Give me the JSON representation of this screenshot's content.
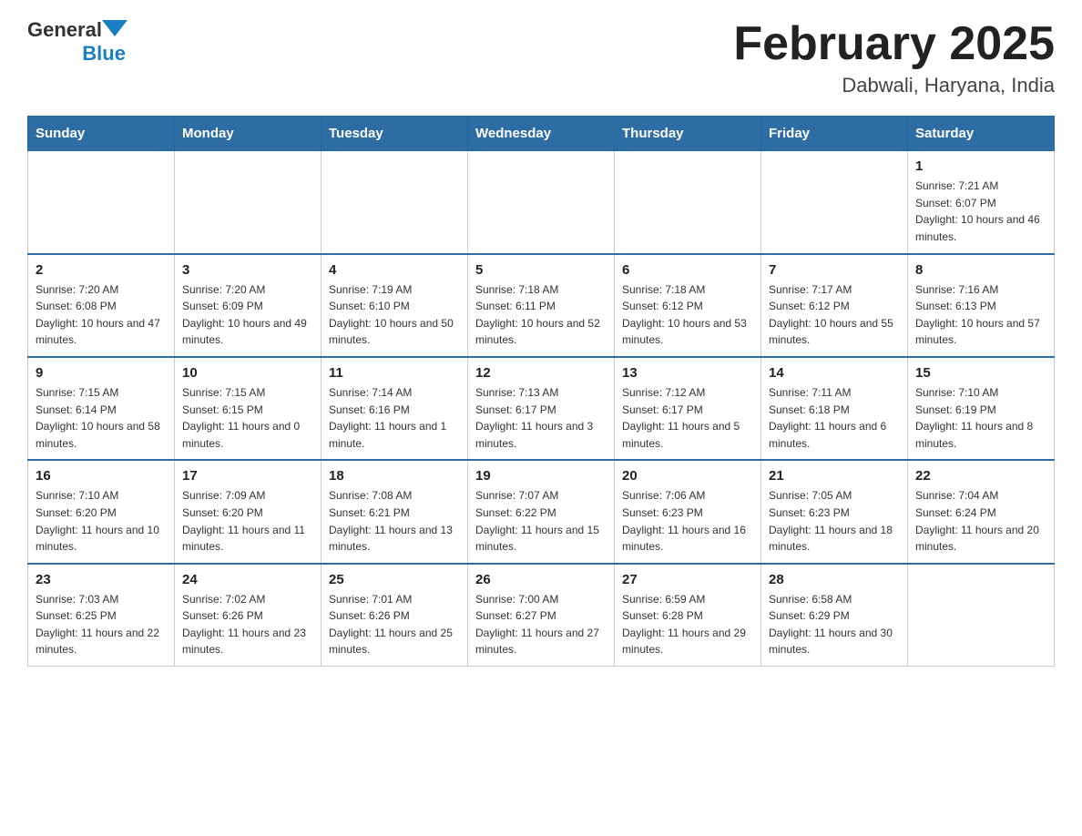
{
  "header": {
    "logo": {
      "general": "General",
      "blue": "Blue"
    },
    "title": "February 2025",
    "subtitle": "Dabwali, Haryana, India"
  },
  "weekdays": [
    "Sunday",
    "Monday",
    "Tuesday",
    "Wednesday",
    "Thursday",
    "Friday",
    "Saturday"
  ],
  "weeks": [
    [
      {
        "day": "",
        "info": ""
      },
      {
        "day": "",
        "info": ""
      },
      {
        "day": "",
        "info": ""
      },
      {
        "day": "",
        "info": ""
      },
      {
        "day": "",
        "info": ""
      },
      {
        "day": "",
        "info": ""
      },
      {
        "day": "1",
        "info": "Sunrise: 7:21 AM\nSunset: 6:07 PM\nDaylight: 10 hours and 46 minutes."
      }
    ],
    [
      {
        "day": "2",
        "info": "Sunrise: 7:20 AM\nSunset: 6:08 PM\nDaylight: 10 hours and 47 minutes."
      },
      {
        "day": "3",
        "info": "Sunrise: 7:20 AM\nSunset: 6:09 PM\nDaylight: 10 hours and 49 minutes."
      },
      {
        "day": "4",
        "info": "Sunrise: 7:19 AM\nSunset: 6:10 PM\nDaylight: 10 hours and 50 minutes."
      },
      {
        "day": "5",
        "info": "Sunrise: 7:18 AM\nSunset: 6:11 PM\nDaylight: 10 hours and 52 minutes."
      },
      {
        "day": "6",
        "info": "Sunrise: 7:18 AM\nSunset: 6:12 PM\nDaylight: 10 hours and 53 minutes."
      },
      {
        "day": "7",
        "info": "Sunrise: 7:17 AM\nSunset: 6:12 PM\nDaylight: 10 hours and 55 minutes."
      },
      {
        "day": "8",
        "info": "Sunrise: 7:16 AM\nSunset: 6:13 PM\nDaylight: 10 hours and 57 minutes."
      }
    ],
    [
      {
        "day": "9",
        "info": "Sunrise: 7:15 AM\nSunset: 6:14 PM\nDaylight: 10 hours and 58 minutes."
      },
      {
        "day": "10",
        "info": "Sunrise: 7:15 AM\nSunset: 6:15 PM\nDaylight: 11 hours and 0 minutes."
      },
      {
        "day": "11",
        "info": "Sunrise: 7:14 AM\nSunset: 6:16 PM\nDaylight: 11 hours and 1 minute."
      },
      {
        "day": "12",
        "info": "Sunrise: 7:13 AM\nSunset: 6:17 PM\nDaylight: 11 hours and 3 minutes."
      },
      {
        "day": "13",
        "info": "Sunrise: 7:12 AM\nSunset: 6:17 PM\nDaylight: 11 hours and 5 minutes."
      },
      {
        "day": "14",
        "info": "Sunrise: 7:11 AM\nSunset: 6:18 PM\nDaylight: 11 hours and 6 minutes."
      },
      {
        "day": "15",
        "info": "Sunrise: 7:10 AM\nSunset: 6:19 PM\nDaylight: 11 hours and 8 minutes."
      }
    ],
    [
      {
        "day": "16",
        "info": "Sunrise: 7:10 AM\nSunset: 6:20 PM\nDaylight: 11 hours and 10 minutes."
      },
      {
        "day": "17",
        "info": "Sunrise: 7:09 AM\nSunset: 6:20 PM\nDaylight: 11 hours and 11 minutes."
      },
      {
        "day": "18",
        "info": "Sunrise: 7:08 AM\nSunset: 6:21 PM\nDaylight: 11 hours and 13 minutes."
      },
      {
        "day": "19",
        "info": "Sunrise: 7:07 AM\nSunset: 6:22 PM\nDaylight: 11 hours and 15 minutes."
      },
      {
        "day": "20",
        "info": "Sunrise: 7:06 AM\nSunset: 6:23 PM\nDaylight: 11 hours and 16 minutes."
      },
      {
        "day": "21",
        "info": "Sunrise: 7:05 AM\nSunset: 6:23 PM\nDaylight: 11 hours and 18 minutes."
      },
      {
        "day": "22",
        "info": "Sunrise: 7:04 AM\nSunset: 6:24 PM\nDaylight: 11 hours and 20 minutes."
      }
    ],
    [
      {
        "day": "23",
        "info": "Sunrise: 7:03 AM\nSunset: 6:25 PM\nDaylight: 11 hours and 22 minutes."
      },
      {
        "day": "24",
        "info": "Sunrise: 7:02 AM\nSunset: 6:26 PM\nDaylight: 11 hours and 23 minutes."
      },
      {
        "day": "25",
        "info": "Sunrise: 7:01 AM\nSunset: 6:26 PM\nDaylight: 11 hours and 25 minutes."
      },
      {
        "day": "26",
        "info": "Sunrise: 7:00 AM\nSunset: 6:27 PM\nDaylight: 11 hours and 27 minutes."
      },
      {
        "day": "27",
        "info": "Sunrise: 6:59 AM\nSunset: 6:28 PM\nDaylight: 11 hours and 29 minutes."
      },
      {
        "day": "28",
        "info": "Sunrise: 6:58 AM\nSunset: 6:29 PM\nDaylight: 11 hours and 30 minutes."
      },
      {
        "day": "",
        "info": ""
      }
    ]
  ]
}
